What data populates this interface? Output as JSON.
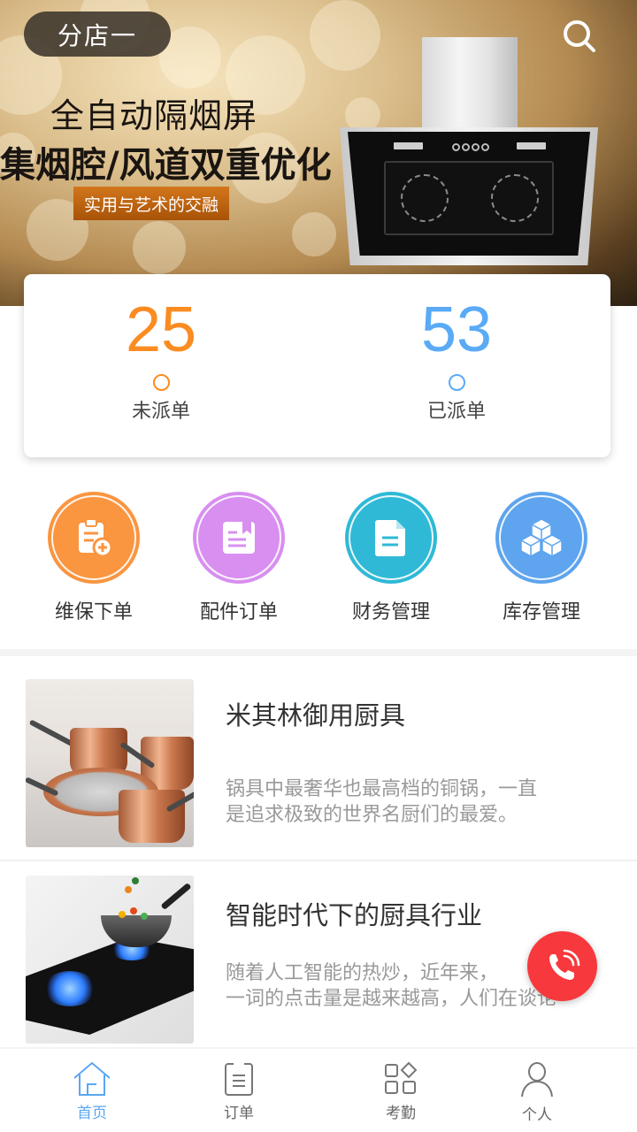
{
  "banner": {
    "store_selector": "分店一",
    "headline_1": "全自动隔烟屏",
    "headline_2": "集烟腔/风道双重优化",
    "tagline": "实用与艺术的交融",
    "search_icon": "search-icon"
  },
  "stats": {
    "pending": {
      "value": "25",
      "label": "未派单",
      "color": "#fb8c22"
    },
    "dispatched": {
      "value": "53",
      "label": "已派单",
      "color": "#5aaaf6"
    }
  },
  "actions": [
    {
      "label": "维保下单",
      "icon": "clipboard-add-icon",
      "color": "#fa9540"
    },
    {
      "label": "配件订单",
      "icon": "bookmark-doc-icon",
      "color": "#d88ff0"
    },
    {
      "label": "财务管理",
      "icon": "file-icon",
      "color": "#2fb9d6"
    },
    {
      "label": "库存管理",
      "icon": "cubes-icon",
      "color": "#5ea4ee"
    }
  ],
  "news": [
    {
      "title": "米其林御用厨具",
      "desc_line1": "锅具中最奢华也最高档的铜锅，一直",
      "desc_line2": "是追求极致的世界名厨们的最爱。"
    },
    {
      "title": "智能时代下的厨具行业",
      "desc_line1": "随着人工智能的热炒，近年来，",
      "desc_line2": "一词的点击量是越来越高，人们在谈论"
    }
  ],
  "call_button": {
    "icon": "phone-icon",
    "color": "#f7383c"
  },
  "tabbar": {
    "active_color": "#5aa7f0",
    "items": [
      {
        "label": "首页",
        "icon": "home-icon",
        "active": true
      },
      {
        "label": "订单",
        "icon": "clipboard-icon",
        "active": false
      },
      {
        "label": "考勤",
        "icon": "apps-icon",
        "active": false
      },
      {
        "label": "个人",
        "icon": "user-icon",
        "active": false
      }
    ]
  }
}
